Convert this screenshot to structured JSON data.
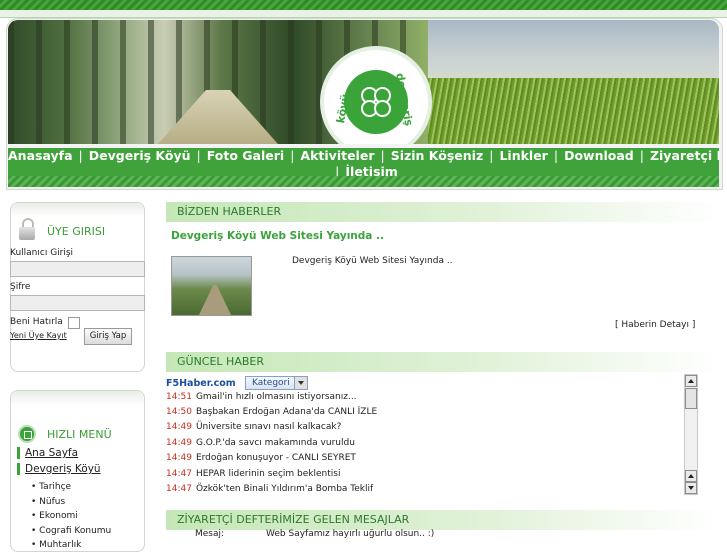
{
  "header": {
    "logo_text_right": "devgeriş",
    "logo_text_left": "köyü"
  },
  "nav": {
    "items": [
      "Anasayfa",
      "Devgeriş Köyü",
      "Foto Galeri",
      "Aktiviteler",
      "Sizin Köşeniz",
      "Linkler",
      "Download",
      "Ziyaretçi Defteri",
      "İletişim"
    ],
    "separator": "|"
  },
  "login": {
    "title": "ÜYE GIRISI",
    "username_label": "Kullanıcı Girişi",
    "password_label": "Şifre",
    "remember_label": "Beni Hatırla",
    "register_link": "Yeni Üye Kayıt",
    "submit_label": "Giriş Yap"
  },
  "quick_menu": {
    "title": "HIZLI MENÜ",
    "main_items": [
      "Ana Sayfa",
      "Devgeriş Köyü"
    ],
    "sub_items": [
      "• Tarihçe",
      "• Nüfus",
      "• Ekonomi",
      "• Cografi Konumu",
      "• Muhtarlık"
    ]
  },
  "news": {
    "section_title": "BİZDEN HABERLER",
    "headline": "Devgeriş Köyü Web Sitesi Yayında ..",
    "summary": "Devgeriş Köyü Web Sitesi Yayında ..",
    "detail_link": "[ Haberin Detayı ]"
  },
  "current_news": {
    "section_title": "GÜNCEL HABER",
    "source": "F5Haber.com",
    "category_label": "Kategori",
    "items": [
      {
        "time": "14:51",
        "text": "Gmail'in hızlı olmasını istiyorsanız..."
      },
      {
        "time": "14:50",
        "text": "Başbakan Erdoğan Adana'da CANLI İZLE"
      },
      {
        "time": "14:49",
        "text": "Üniversite sınavı nasıl kalkacak?"
      },
      {
        "time": "14:49",
        "text": "G.O.P.'da savcı makamında vuruldu"
      },
      {
        "time": "14:49",
        "text": "Erdoğan konuşuyor - CANLI SEYRET"
      },
      {
        "time": "14:47",
        "text": "HEPAR liderinin seçim beklentisi"
      },
      {
        "time": "14:47",
        "text": "Özkök'ten Binali Yıldırım'a Bomba Teklif"
      }
    ]
  },
  "guestbook": {
    "section_title": "ZİYARETÇİ DEFTERİMİZE GELEN MESAJLAR",
    "message_label": "Mesaj:",
    "message_text": "Web Sayfamız hayırlı uğurlu olsun.. :)"
  }
}
